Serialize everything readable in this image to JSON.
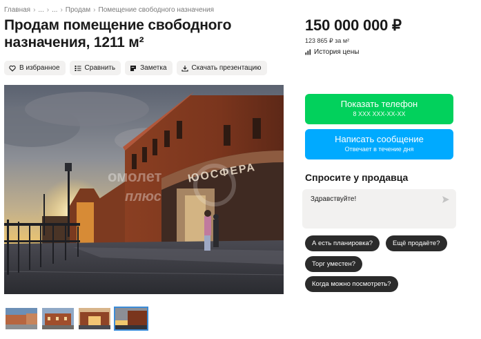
{
  "breadcrumb": {
    "items": [
      "Главная",
      "...",
      "...",
      "Продам",
      "Помещение свободного назначения"
    ],
    "sep": "›"
  },
  "listing": {
    "title": "Продам помещение свободного назначения, 1211 м²"
  },
  "actions": {
    "favorite": "В избранное",
    "compare": "Сравнить",
    "note": "Заметка",
    "presentation": "Скачать презентацию"
  },
  "photo": {
    "watermark_line1": "омолет",
    "watermark_line2": "плюс",
    "sign_text": "ЮОСФЕРА"
  },
  "price": {
    "value": "150 000 000 ₽",
    "per_m2": "123 865 ₽ за м²",
    "history": "История цены"
  },
  "contact": {
    "phone_label": "Показать телефон",
    "phone_masked": "8 XXX XXX-XX-XX",
    "message_label": "Написать сообщение",
    "message_sub": "Отвечает в течение дня"
  },
  "ask": {
    "title": "Спросите у продавца",
    "message": "Здравствуйте!",
    "chips": [
      "А есть планировка?",
      "Ещё продаёте?",
      "Торг уместен?",
      "Когда можно посмотреть?"
    ]
  },
  "colors": {
    "phone": "#02d15c",
    "message": "#00aaff",
    "chip": "#2b2b2b"
  },
  "icons": {
    "favorite": "heart-icon",
    "compare": "compare-icon",
    "note": "note-icon",
    "presentation": "download-icon",
    "history": "chart-icon",
    "send": "send-icon"
  }
}
